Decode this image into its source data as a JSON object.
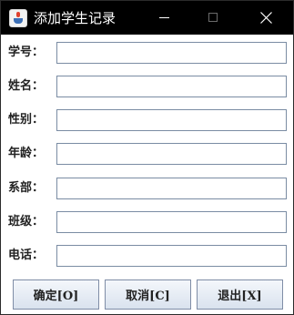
{
  "window": {
    "title": "添加学生记录"
  },
  "form": {
    "fields": [
      {
        "label": "学号：",
        "value": ""
      },
      {
        "label": "姓名：",
        "value": ""
      },
      {
        "label": "性别：",
        "value": ""
      },
      {
        "label": "年龄：",
        "value": ""
      },
      {
        "label": "系部：",
        "value": ""
      },
      {
        "label": "班级：",
        "value": ""
      },
      {
        "label": "电话：",
        "value": ""
      }
    ]
  },
  "buttons": {
    "ok": "确定[O]",
    "cancel": "取消[C]",
    "exit": "退出[X]"
  },
  "colors": {
    "titlebar_bg": "#000000",
    "input_border": "#7a8ca3",
    "button_gradient_top": "#f4f7fb",
    "button_gradient_bottom": "#d9e2ee"
  },
  "icons": {
    "app": "java-cup-icon",
    "minimize": "minimize-icon",
    "maximize": "maximize-icon",
    "close": "close-icon"
  }
}
